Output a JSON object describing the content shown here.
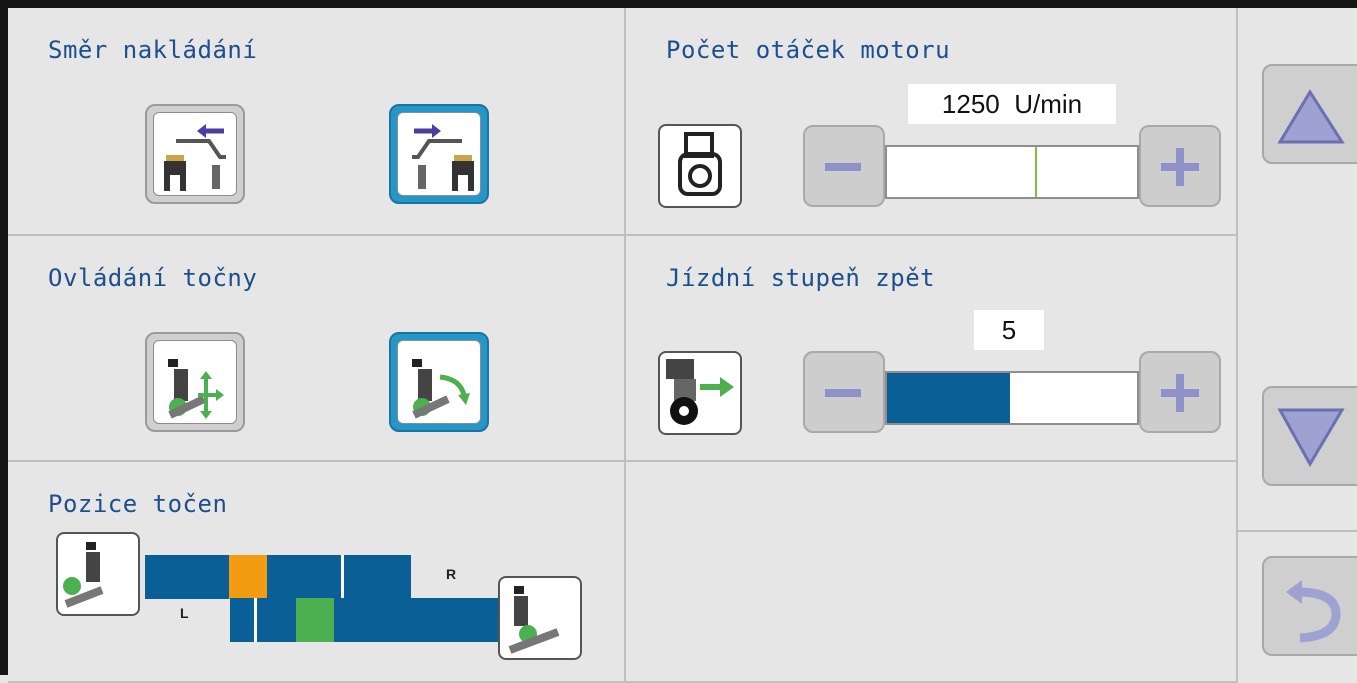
{
  "panels": {
    "loading_direction": {
      "title": "Směr nakládání"
    },
    "engine_speed": {
      "title": "Počet otáček motoru",
      "value": "1250  U/min",
      "minus_label": "−",
      "plus_label": "+"
    },
    "turntable_control": {
      "title": "Ovládání točny"
    },
    "reverse_gear": {
      "title": "Jízdní stupeň zpět",
      "value": "5",
      "level_fraction": 0.49
    },
    "turntable_position": {
      "title": "Pozice točen",
      "label_right": "R",
      "label_left": "L"
    }
  },
  "nav": {
    "up": "triangle-up-icon",
    "down": "triangle-down-icon",
    "back": "return-arrow-icon"
  },
  "colors": {
    "title": "#1d4f8e",
    "bar_blue": "#0a5f96",
    "selected": "#2596c8",
    "orange": "#f39c12",
    "green": "#4caf50",
    "engine_marker": "#7fc242"
  }
}
